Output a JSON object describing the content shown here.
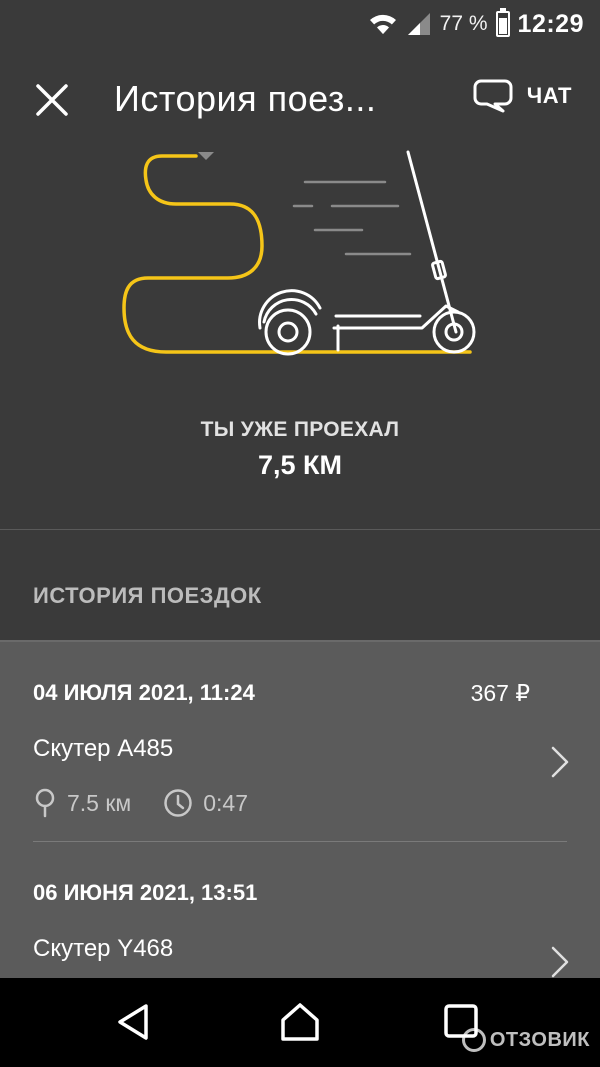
{
  "status_bar": {
    "battery_percent": "77 %",
    "time": "12:29"
  },
  "header": {
    "title": "История поез...",
    "chat_label": "ЧАТ"
  },
  "hero": {
    "caption": "ТЫ УЖЕ ПРОЕХАЛ",
    "distance": "7,5 КМ"
  },
  "history": {
    "section_title": "ИСТОРИЯ ПОЕЗДОК"
  },
  "trips": [
    {
      "date": "04 ИЮЛЯ 2021, 11:24",
      "price": "367 ₽",
      "vehicle": "Скутер A485",
      "distance": "7.5 км",
      "duration": "0:47"
    },
    {
      "date": "06 ИЮНЯ 2021, 13:51",
      "vehicle": "Скутер Y468"
    }
  ],
  "watermark": "ОТЗОВИК",
  "colors": {
    "accent": "#f5c518",
    "background": "#3a3a3a",
    "list_bg": "#5b5b5b"
  },
  "icons": [
    "wifi-icon",
    "signal-icon",
    "battery-icon",
    "close-icon",
    "chat-icon",
    "pin-icon",
    "clock-icon",
    "chevron-right-icon",
    "back-icon",
    "home-icon",
    "recents-icon"
  ]
}
